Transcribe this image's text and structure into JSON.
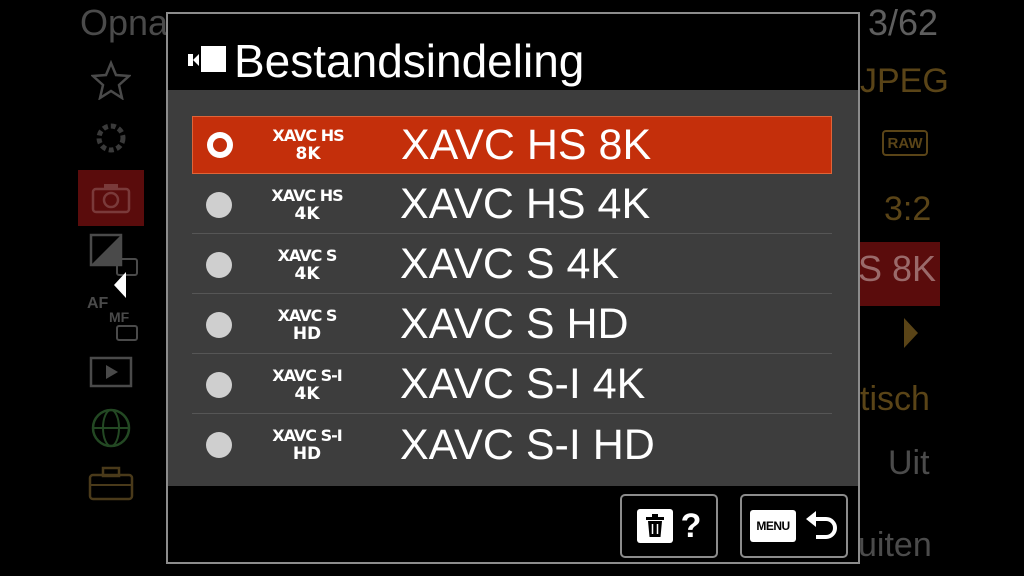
{
  "background": {
    "title": "Opna",
    "page_counter": "3/62",
    "side_items": [
      {
        "icon": "star-icon"
      },
      {
        "icon": "settings-icon"
      },
      {
        "icon": "camera-icon"
      },
      {
        "icon": "exposure-icon"
      },
      {
        "icon": "af-mf-icon",
        "label": "AF MF"
      },
      {
        "icon": "play-icon"
      },
      {
        "icon": "globe-icon"
      },
      {
        "icon": "toolbox-icon"
      }
    ],
    "right_values": {
      "format": "JPEG",
      "raw": "RAW",
      "ratio": "3:2",
      "selected": "S 8K",
      "auto": "tisch",
      "off": "Uit",
      "exit": "uiten"
    }
  },
  "dialog": {
    "title": "Bestandsindeling",
    "title_icon": "movie-icon",
    "options": [
      {
        "badge_top": "XAVC HS",
        "badge_bottom": "8K",
        "label": "XAVC HS 8K",
        "selected": true
      },
      {
        "badge_top": "XAVC HS",
        "badge_bottom": "4K",
        "label": "XAVC HS 4K",
        "selected": false
      },
      {
        "badge_top": "XAVC S",
        "badge_bottom": "4K",
        "label": "XAVC S 4K",
        "selected": false
      },
      {
        "badge_top": "XAVC S",
        "badge_bottom": "HD",
        "label": "XAVC S HD",
        "selected": false
      },
      {
        "badge_top": "XAVC S-I",
        "badge_bottom": "4K",
        "label": "XAVC S-I 4K",
        "selected": false
      },
      {
        "badge_top": "XAVC S-I",
        "badge_bottom": "HD",
        "label": "XAVC S-I HD",
        "selected": false
      }
    ],
    "help_button": {
      "icon": "trash-icon",
      "label": "?"
    },
    "back_button": {
      "menu_label": "MENU",
      "icon": "return-arrow-icon"
    }
  },
  "colors": {
    "selected_row": "#c42f0b",
    "list_background": "#3d3d3d",
    "dimmed_accent": "#5a4417"
  }
}
